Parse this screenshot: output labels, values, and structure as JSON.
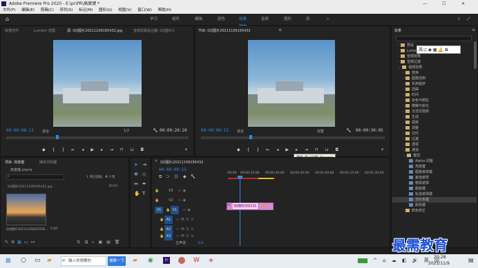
{
  "app": {
    "title": "Adobe Premiere Pro 2020 - E:\\pr\\PR\\高度键 *"
  },
  "menu": [
    "文件(F)",
    "编辑(E)",
    "剪辑(C)",
    "序列(S)",
    "标记(M)",
    "图形(G)",
    "视图(V)",
    "窗口(W)",
    "帮助(H)"
  ],
  "workspaces": [
    "学习",
    "组件",
    "编辑",
    "颜色",
    "效果",
    "音频",
    "图形",
    "库"
  ],
  "source": {
    "tabs": [
      "效果控件",
      "Lumetri 范围",
      "源: QQ图片20211109195432.jpg",
      "音频剪辑混合器: QQ图片2"
    ],
    "tc_in": "00:00:08:13",
    "fit": "适合",
    "fraction": "1/2",
    "tc_out": "00:00:20:20"
  },
  "program": {
    "title": "节目: QQ图片20211109195432",
    "tc_in": "00:00:08:13",
    "fit": "适合",
    "quality": "完整",
    "tc_out": "00:00:30:05",
    "tooltip": "播放-停止切换 (Space)"
  },
  "project": {
    "tabs": [
      "项目: 高度键",
      "媒体浏览器"
    ],
    "file": "高度键.prproj",
    "count": "1 项已选择，共 3 项",
    "item1": "QQ图片20211109195432.jpg",
    "item2": "QQ图片20211109202556...",
    "item2_dur": "5:00",
    "item1_dur": "30:05"
  },
  "timeline": {
    "title": "QQ图片20211109195432",
    "tc": "00:00:08:13",
    "ruler": [
      ":00:00",
      "00:00:15:00",
      "00:00:30:00",
      "00:00:45:00",
      "00:01:00:00",
      "00:01:15:00",
      "00:01:30:00"
    ],
    "video_tracks": [
      "V3",
      "V2",
      "V1"
    ],
    "audio_tracks": [
      "A1",
      "A2",
      "A3"
    ],
    "master": "主声道",
    "master_val": "0.0",
    "clip_label": "QQ图片202111"
  },
  "effects": {
    "title": "效果",
    "search_lines": [
      "预设",
      "Lumetri 预设",
      "音频效果",
      "音频过渡",
      "视频效果",
      "变换",
      "图像控制",
      "实用程序",
      "扭曲",
      "时间",
      "杂色与颗粒",
      "模糊与锐化",
      "沉浸式视频",
      "生成",
      "视频",
      "调整",
      "过时",
      "过渡",
      "透视",
      "通道",
      "键控",
      "Alpha 调整",
      "亮度键",
      "图像遮罩键",
      "差值遮罩",
      "移除遮罩",
      "超级键",
      "轨道遮罩键",
      "非红色键",
      "颜色键",
      "颜色校正"
    ]
  },
  "watermark": "最需教育",
  "taskbar": {
    "search_placeholder": "输入你想要的",
    "search_btn": "搜索一下",
    "time": "20:28",
    "date": "2021/11/9",
    "ime": "英"
  }
}
